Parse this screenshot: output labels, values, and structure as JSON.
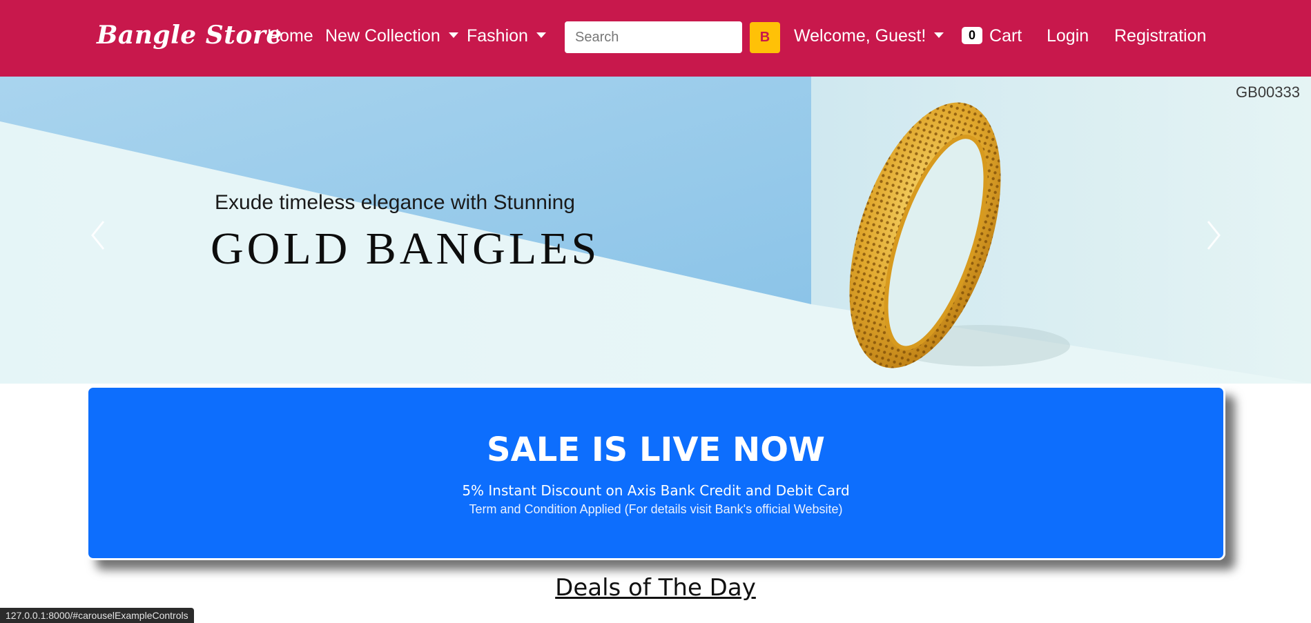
{
  "navbar": {
    "brand": "Bangle Store",
    "home": "Home",
    "new_collection": "New Collection",
    "fashion": "Fashion",
    "search_placeholder": "Search",
    "search_button": "B",
    "welcome": "Welcome, Guest!",
    "cart_count": "0",
    "cart": "Cart",
    "login": "Login",
    "registration": "Registration",
    "colors": {
      "background": "#c8184c",
      "search_button": "#ffc107"
    }
  },
  "carousel": {
    "product_code": "GB00333",
    "tagline": "Exude timeless elegance with Stunning",
    "title": "GOLD BANGLES",
    "prev_icon": "chevron-left-icon",
    "next_icon": "chevron-right-icon"
  },
  "sale_banner": {
    "title": "SALE IS LIVE NOW",
    "line1": "5% Instant Discount on Axis Bank Credit and Debit Card",
    "line2": "Term and Condition Applied (For details visit Bank's official Website)",
    "color": "#0d6efd"
  },
  "deals": {
    "heading": "Deals of The Day"
  },
  "status_bar": {
    "url": "127.0.0.1:8000/#carouselExampleControls"
  }
}
